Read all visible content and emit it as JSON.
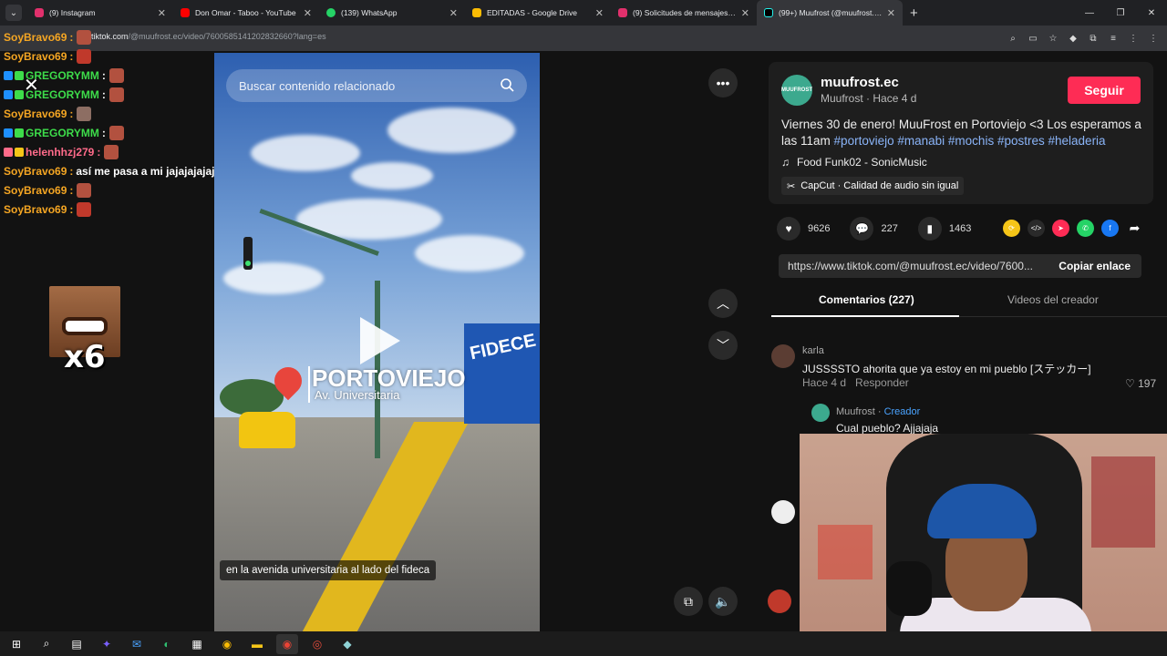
{
  "browser": {
    "tabs": [
      {
        "label": "(9) Instagram",
        "color": "#e1306c"
      },
      {
        "label": "Don Omar - Taboo - YouTube",
        "color": "#ff0000"
      },
      {
        "label": "(139) WhatsApp",
        "color": "#25d366"
      },
      {
        "label": "EDITADAS - Google Drive",
        "color": "#fbbc04"
      },
      {
        "label": "(9) Solicitudes de mensajes • M",
        "color": "#e1306c"
      },
      {
        "label": "(99+) Muufrost (@muufrost.ec)",
        "color": "#000000"
      }
    ],
    "address": {
      "host": "tiktok.com",
      "path": "/@muufrost.ec/video/7600585141202832660?lang=es"
    }
  },
  "chat": {
    "messages": [
      {
        "user": "SoyBravo69",
        "color": "#f5a623",
        "text": ""
      },
      {
        "user": "SoyBravo69",
        "color": "#f5a623",
        "text": ""
      },
      {
        "user": "GREGORYMM",
        "color": "#3ddc4a",
        "text": ""
      },
      {
        "user": "GREGORYMM",
        "color": "#3ddc4a",
        "text": ""
      },
      {
        "user": "SoyBravo69",
        "color": "#f5a623",
        "text": ""
      },
      {
        "user": "GREGORYMM",
        "color": "#3ddc4a",
        "text": ""
      },
      {
        "user": "helenhhzj279",
        "color": "#ff6b8a",
        "text": ""
      },
      {
        "user": "SoyBravo69",
        "color": "#f5a623",
        "text": "así me pasa a mi jajajajajajaja"
      },
      {
        "user": "SoyBravo69",
        "color": "#f5a623",
        "text": ""
      },
      {
        "user": "SoyBravo69",
        "color": "#f5a623",
        "text": ""
      }
    ],
    "emote_combo": "x6"
  },
  "video": {
    "search_placeholder": "Buscar contenido relacionado",
    "location_title": "PORTOVIEJO",
    "location_sub": "Av. Universitaria",
    "store_sign": "FIDECE",
    "caption": "en la avenida universitaria al lado del fideca"
  },
  "post": {
    "account": "muufrost.ec",
    "avatar_text": "MUUFROST",
    "author": "Muufrost",
    "time": "Hace 4 d",
    "follow_label": "Seguir",
    "description": "Viernes 30 de enero! MuuFrost en Portoviejo <3 Los esperamos a las 11am",
    "hashtags": [
      "#portoviejo",
      "#manabi",
      "#mochis",
      "#postres",
      "#heladeria"
    ],
    "music": "Food Funk02 - SonicMusic",
    "capcut": "CapCut · Calidad de audio sin igual",
    "likes": "9626",
    "comments": "227",
    "saves": "1463",
    "link": "https://www.tiktok.com/@muufrost.ec/video/7600...",
    "copy_label": "Copiar enlace",
    "tab_comments": "Comentarios (227)",
    "tab_videos": "Videos del creador"
  },
  "comments": [
    {
      "user": "karla",
      "text": "JUSSSSTO ahorita que ya estoy en mi pueblo [ステッカー]",
      "time": "Hace 4 d",
      "reply": "Responder",
      "likes": "197"
    }
  ],
  "reply": {
    "user": "Muufrost",
    "badge": "Creador",
    "text": "Cual pueblo? Ajjajaja"
  }
}
